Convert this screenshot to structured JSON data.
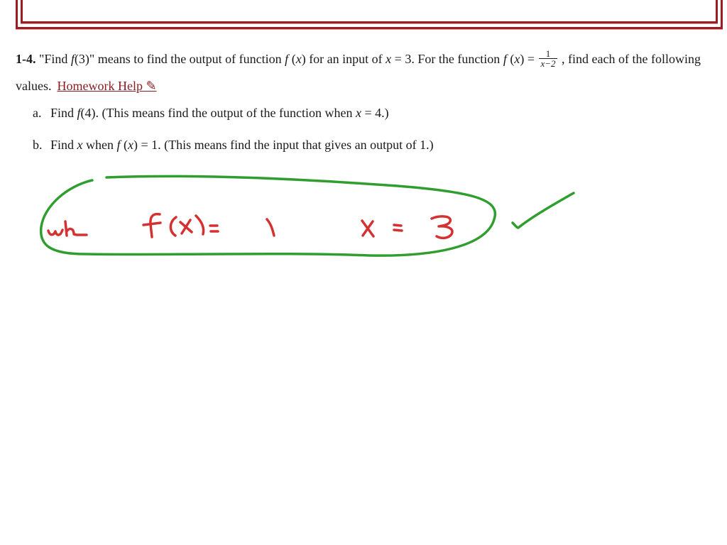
{
  "problem": {
    "number": "1-4.",
    "intro_1": " \"Find ",
    "f_letter": "f",
    "intro_2": "(3)\" means to find the output of function ",
    "fx_f": "f",
    "fx_open": " (",
    "fx_x": "x",
    "fx_close": ")",
    "intro_3": " for an input of ",
    "x_var": "x",
    "intro_4": " = 3. For the function ",
    "fx2_f": "f",
    "fx2_open": " (",
    "fx2_x": "x",
    "fx2_close": ") = ",
    "frac_num": "1",
    "frac_den": "x−2",
    "intro_5": " , find each of the following values.",
    "help_link": "Homework Help ✎"
  },
  "parts": [
    {
      "label": "a.",
      "text_1": "Find ",
      "f": "f",
      "text_2": "(4). (This means find the output of the function when ",
      "x": "x",
      "text_3": " = 4.)"
    },
    {
      "label": "b.",
      "text_1": "Find ",
      "x": "x",
      "text_2": " when ",
      "f": "f",
      "text_3": " (",
      "x2": "x",
      "text_4": ") = 1. (This means find the input that gives an output of 1.)"
    }
  ],
  "annotation": {
    "handwritten_text": "when f(x) = 1    x = 3",
    "ink_colors": {
      "answer": "#d63131",
      "circle": "#2f9e2f",
      "check": "#2f9e2f"
    },
    "frame_color": "#9b1c22"
  }
}
